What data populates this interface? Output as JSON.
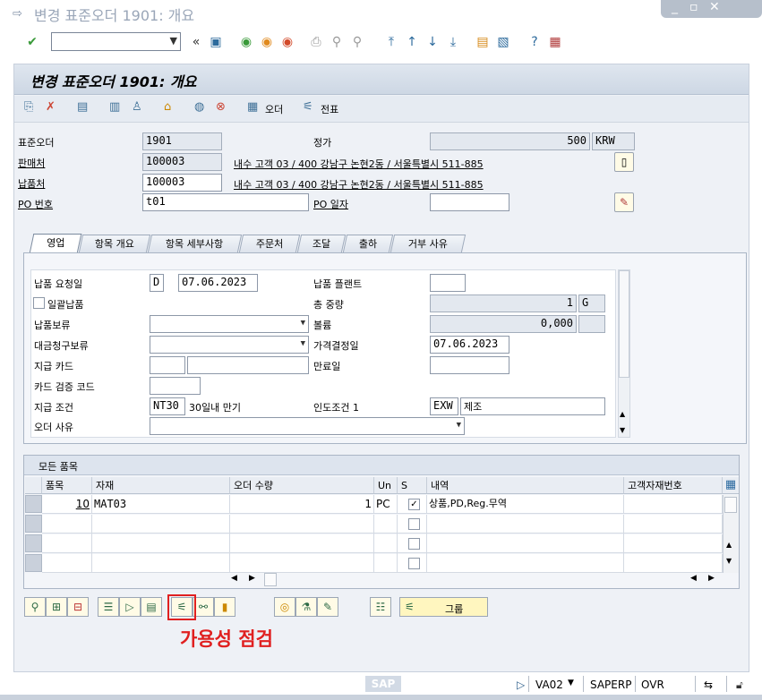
{
  "window": {
    "title": "변경 표준오더 1901: 개요"
  },
  "page": {
    "title": "변경 표준오더 1901: 개요"
  },
  "app_toolbar": {
    "order_label": "오더",
    "document_label": "전표"
  },
  "header": {
    "std_order_label": "표준오더",
    "std_order_value": "1901",
    "net_value_label": "정가",
    "net_value": "500",
    "currency": "KRW",
    "sold_to_label": "판매처",
    "sold_to_value": "100003",
    "sold_to_desc": "내수 고객 03 / 400 강남구 논현2동 / 서울특별시 511-885",
    "ship_to_label": "납품처",
    "ship_to_value": "100003",
    "ship_to_desc": "내수 고객 03 / 400 강남구 논현2동 / 서울특별시 511-885",
    "po_number_label": "PO 번호",
    "po_number_value": "t01",
    "po_date_label": "PO 일자",
    "po_date_value": ""
  },
  "tabs": [
    {
      "label": "영업",
      "active": true
    },
    {
      "label": "항목 개요",
      "active": false
    },
    {
      "label": "항목 세부사항",
      "active": false
    },
    {
      "label": "주문처",
      "active": false
    },
    {
      "label": "조달",
      "active": false
    },
    {
      "label": "출하",
      "active": false
    },
    {
      "label": "거부 사유",
      "active": false
    }
  ],
  "sales_tab": {
    "req_deliv_date_label": "납품 요청일",
    "req_deliv_date_type": "D",
    "req_deliv_date": "07.06.2023",
    "deliv_plant_label": "납품 플랜트",
    "deliv_plant": "",
    "complete_deliv_label": "일괄납품",
    "total_weight_label": "총 중량",
    "total_weight": "1",
    "weight_unit": "G",
    "deliv_block_label": "납품보류",
    "deliv_block": "",
    "volume_label": "볼륨",
    "volume": "0,000",
    "billing_block_label": "대금청구보류",
    "billing_block": "",
    "pricing_date_label": "가격결정일",
    "pricing_date": "07.06.2023",
    "payment_card_label": "지급 카드",
    "expiry_label": "만료일",
    "card_verif_label": "카드 검증 코드",
    "payment_terms_label": "지급 조건",
    "payment_terms": "NT30",
    "payment_terms_desc": "30일내 만기",
    "incoterms_label": "인도조건 1",
    "incoterms": "EXW",
    "incoterms_desc": "제조",
    "order_reason_label": "오더 사유",
    "order_reason": ""
  },
  "items": {
    "group_title": "모든 품목",
    "columns": [
      "품목",
      "자재",
      "오더 수량",
      "Un",
      "S",
      "내역",
      "고객자재번호"
    ],
    "rows": [
      {
        "item": "10",
        "material": "MAT03",
        "qty": "1",
        "unit": "PC",
        "checked": true,
        "desc": "상품,PD,Reg.무역",
        "cust_mat": ""
      }
    ]
  },
  "bottom_toolbar": {
    "group_label": "그룹"
  },
  "annotation": {
    "text": "가용성 점검",
    "color": "#e02020"
  },
  "statusbar": {
    "brand": "SAP",
    "tcode": "VA02",
    "system": "SAPERP",
    "mode": "OVR"
  }
}
